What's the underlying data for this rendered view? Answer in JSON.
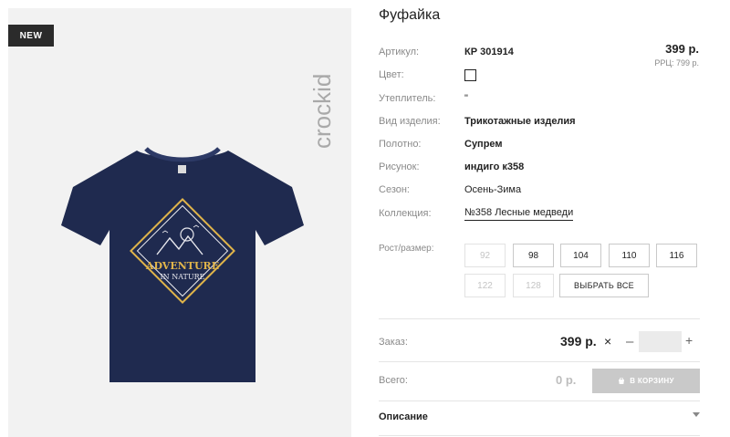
{
  "badge": {
    "new": "NEW"
  },
  "brand": {
    "logo_text": "crockid"
  },
  "product": {
    "title": "Фуфайка",
    "price": "399 р.",
    "rrp": "РРЦ: 799 р."
  },
  "specs": {
    "article": {
      "label": "Артикул:",
      "value": "КР 301914"
    },
    "color": {
      "label": "Цвет:",
      "swatch_color": "#ffffff"
    },
    "insulation": {
      "label": "Утеплитель:",
      "value": "\""
    },
    "type": {
      "label": "Вид изделия:",
      "value": "Трикотажные изделия"
    },
    "fabric": {
      "label": "Полотно:",
      "value": "Супрем"
    },
    "pattern": {
      "label": "Рисунок:",
      "value": "индиго к358"
    },
    "season": {
      "label": "Сезон:",
      "value": "Осень-Зима"
    },
    "collection": {
      "label": "Коллекция:",
      "value": "№358 Лесные медведи"
    }
  },
  "sizes": {
    "label": "Рост/размер:",
    "items": [
      {
        "value": "92",
        "available": false
      },
      {
        "value": "98",
        "available": true
      },
      {
        "value": "104",
        "available": true
      },
      {
        "value": "110",
        "available": true
      },
      {
        "value": "116",
        "available": true
      },
      {
        "value": "122",
        "available": false
      },
      {
        "value": "128",
        "available": false
      }
    ],
    "select_all": "ВЫБРАТЬ ВСЕ"
  },
  "order": {
    "label": "Заказ:",
    "price": "399 р.",
    "times": "×",
    "minus": "–",
    "plus": "+",
    "quantity": ""
  },
  "total": {
    "label": "Всего:",
    "value": "0 р.",
    "cart_button": "В КОРЗИНУ"
  },
  "description": {
    "title": "Описание"
  },
  "shirt_print": {
    "line1": "ADVENTURE",
    "line2": "IN NATURE"
  },
  "colors": {
    "shirt": "#1f2a4f",
    "print_gold": "#e0b44a",
    "print_white": "#e8e8ee"
  }
}
